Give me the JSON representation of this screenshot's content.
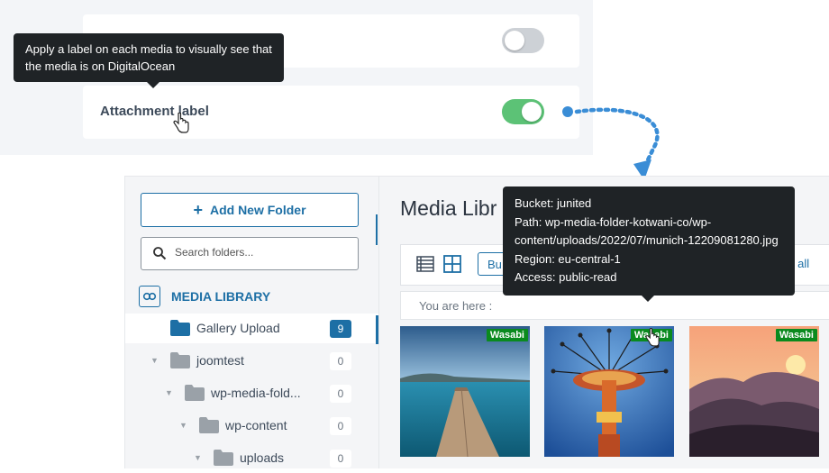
{
  "settings": {
    "tooltip": "Apply a label on each media to visually see that the media is on DigitalOcean",
    "rows": [
      {
        "label": "",
        "toggle_on": false
      },
      {
        "label": "Attachment label",
        "toggle_on": true
      }
    ]
  },
  "media": {
    "add_folder_label": "Add New Folder",
    "search_placeholder": "Search folders...",
    "library_title": "MEDIA LIBRARY",
    "folders": [
      {
        "name": "Gallery Upload",
        "count": "9",
        "active": true
      },
      {
        "name": "joomtest",
        "count": "0",
        "active": false
      },
      {
        "name": "wp-media-fold...",
        "count": "0",
        "active": false
      },
      {
        "name": "wp-content",
        "count": "0",
        "active": false
      },
      {
        "name": "uploads",
        "count": "0",
        "active": false
      }
    ],
    "page_title": "Media Libr",
    "bulk_label": "Bu",
    "apply_all_label": "y all",
    "breadcrumb": "You are here :",
    "badge": "Wasabi",
    "tooltip_lines": [
      "Bucket: junited",
      "Path: wp-media-folder-kotwani-co/wp-content/uploads/2022/07/munich-12209081280.jpg",
      "Region: eu-central-1",
      "Access: public-read"
    ]
  },
  "colors": {
    "accent": "#1d6fa5",
    "toggle_on": "#5cc276",
    "toggle_off": "#cdd1d6",
    "badge": "#0a8a1e",
    "tooltip_bg": "#1f2326",
    "arrow": "#3a8dd6"
  },
  "icons": [
    "plus-icon",
    "search-icon",
    "media-library-icon",
    "folder-icon",
    "caret-down-icon",
    "list-view-icon",
    "grid-view-icon",
    "hand-cursor-icon"
  ]
}
